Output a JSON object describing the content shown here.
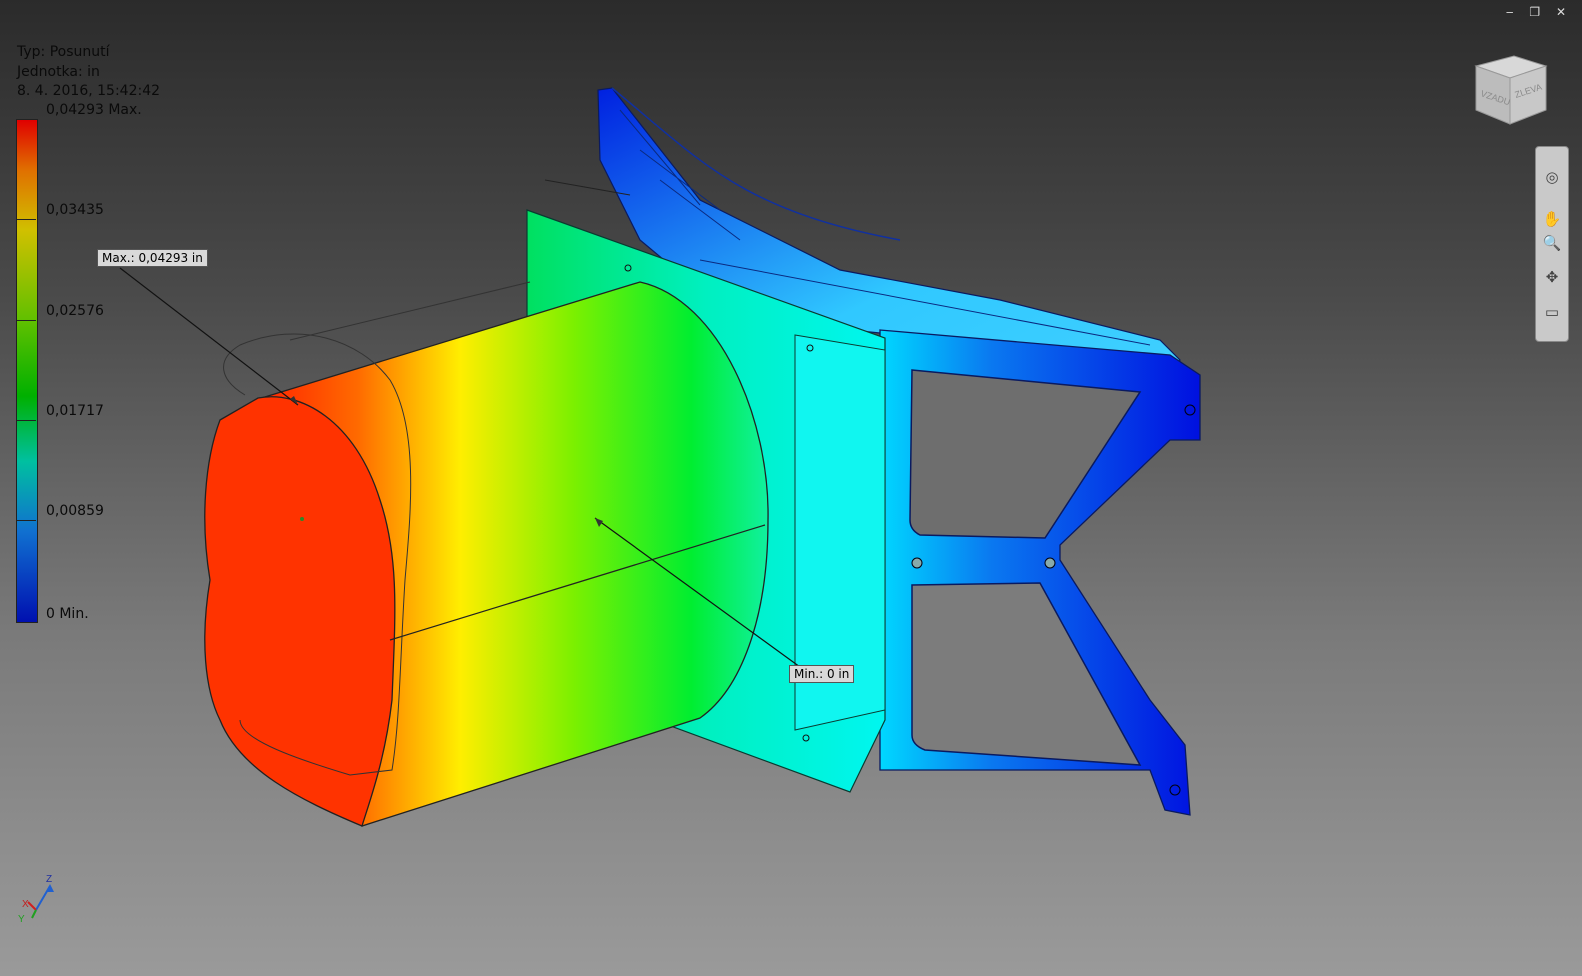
{
  "info": {
    "type_line": "Typ: Posunutí",
    "unit_line": "Jednotka: in",
    "date_line": "8. 4. 2016, 15:42:42"
  },
  "legend": {
    "max_label": "0,04293 Max.",
    "l1": "0,03435",
    "l2": "0,02576",
    "l3": "0,01717",
    "l4": "0,00859",
    "min_label": "0 Min."
  },
  "callouts": {
    "max": "Max.: 0,04293 in",
    "min": "Min.: 0 in"
  },
  "viewcube": {
    "face_left": "VZADU",
    "face_right": "ZLEVA"
  },
  "triad": {
    "x": "X",
    "y": "Y",
    "z": "Z"
  },
  "window_buttons": {
    "minimize": "‒",
    "restore": "❐",
    "close": "✕"
  },
  "colors": {
    "max": "#e00000",
    "min": "#0010b0"
  }
}
